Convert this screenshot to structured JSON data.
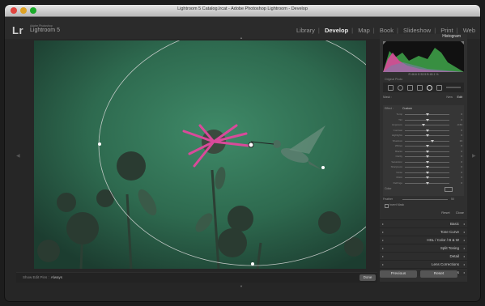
{
  "window": {
    "title": "Lightroom 5 Catalog.lrcat - Adobe Photoshop Lightroom - Develop"
  },
  "identity": {
    "brand": "Lr",
    "vendor": "Adobe Photoshop",
    "product": "Lightroom 5"
  },
  "modules": [
    {
      "label": "Library",
      "active": false
    },
    {
      "label": "Develop",
      "active": true
    },
    {
      "label": "Map",
      "active": false
    },
    {
      "label": "Book",
      "active": false
    },
    {
      "label": "Slideshow",
      "active": false
    },
    {
      "label": "Print",
      "active": false
    },
    {
      "label": "Web",
      "active": false
    }
  ],
  "toolbar": {
    "show_edit_pins_label": "Show Edit Pins :",
    "show_edit_pins_value": "Always",
    "done_label": "Done"
  },
  "histogram": {
    "title": "Histogram",
    "readout": "R 46.6  G 52.5  B 45.1 %",
    "original_photo_label": "Original Photo"
  },
  "mask": {
    "label": "Mask :",
    "new_label": "New",
    "edit_label": "Edit"
  },
  "effect": {
    "header_label": "Effect :",
    "preset_value": "Custom",
    "sliders": [
      {
        "label": "Temp",
        "value": "0",
        "pos": 0.5
      },
      {
        "label": "Tint",
        "value": "0",
        "pos": 0.5
      },
      {
        "label": "Exposure",
        "value": "-0.63",
        "pos": 0.42
      },
      {
        "label": "Contrast",
        "value": "0",
        "pos": 0.5
      },
      {
        "label": "Highlights",
        "value": "0",
        "pos": 0.5
      },
      {
        "label": "Shadows",
        "value": "23",
        "pos": 0.62
      },
      {
        "label": "Whites",
        "value": "0",
        "pos": 0.5
      },
      {
        "label": "Blacks",
        "value": "0",
        "pos": 0.5
      },
      {
        "label": "Clarity",
        "value": "0",
        "pos": 0.5
      },
      {
        "label": "Saturation",
        "value": "0",
        "pos": 0.5
      },
      {
        "label": "Sharpness",
        "value": "0",
        "pos": 0.5
      },
      {
        "label": "Noise",
        "value": "0",
        "pos": 0.5
      },
      {
        "label": "Moiré",
        "value": "0",
        "pos": 0.5
      },
      {
        "label": "Defringe",
        "value": "0",
        "pos": 0.5
      }
    ],
    "color_label": "Color"
  },
  "feather": {
    "label": "Feather",
    "value": "50",
    "invert_label": "Invert Mask"
  },
  "panel_actions": {
    "reset_label": "Reset",
    "close_label": "Close"
  },
  "sections": [
    "Basic",
    "Tone Curve",
    "HSL / Color / B & W",
    "Split Toning",
    "Detail",
    "Lens Corrections",
    "Effects"
  ],
  "nav": {
    "previous_label": "Previous",
    "reset_label": "Reset"
  },
  "colors": {
    "accent_pink": "#d94a9a",
    "backdrop_green": "#2e6a4f",
    "panel_bg": "#2f2f2f"
  }
}
